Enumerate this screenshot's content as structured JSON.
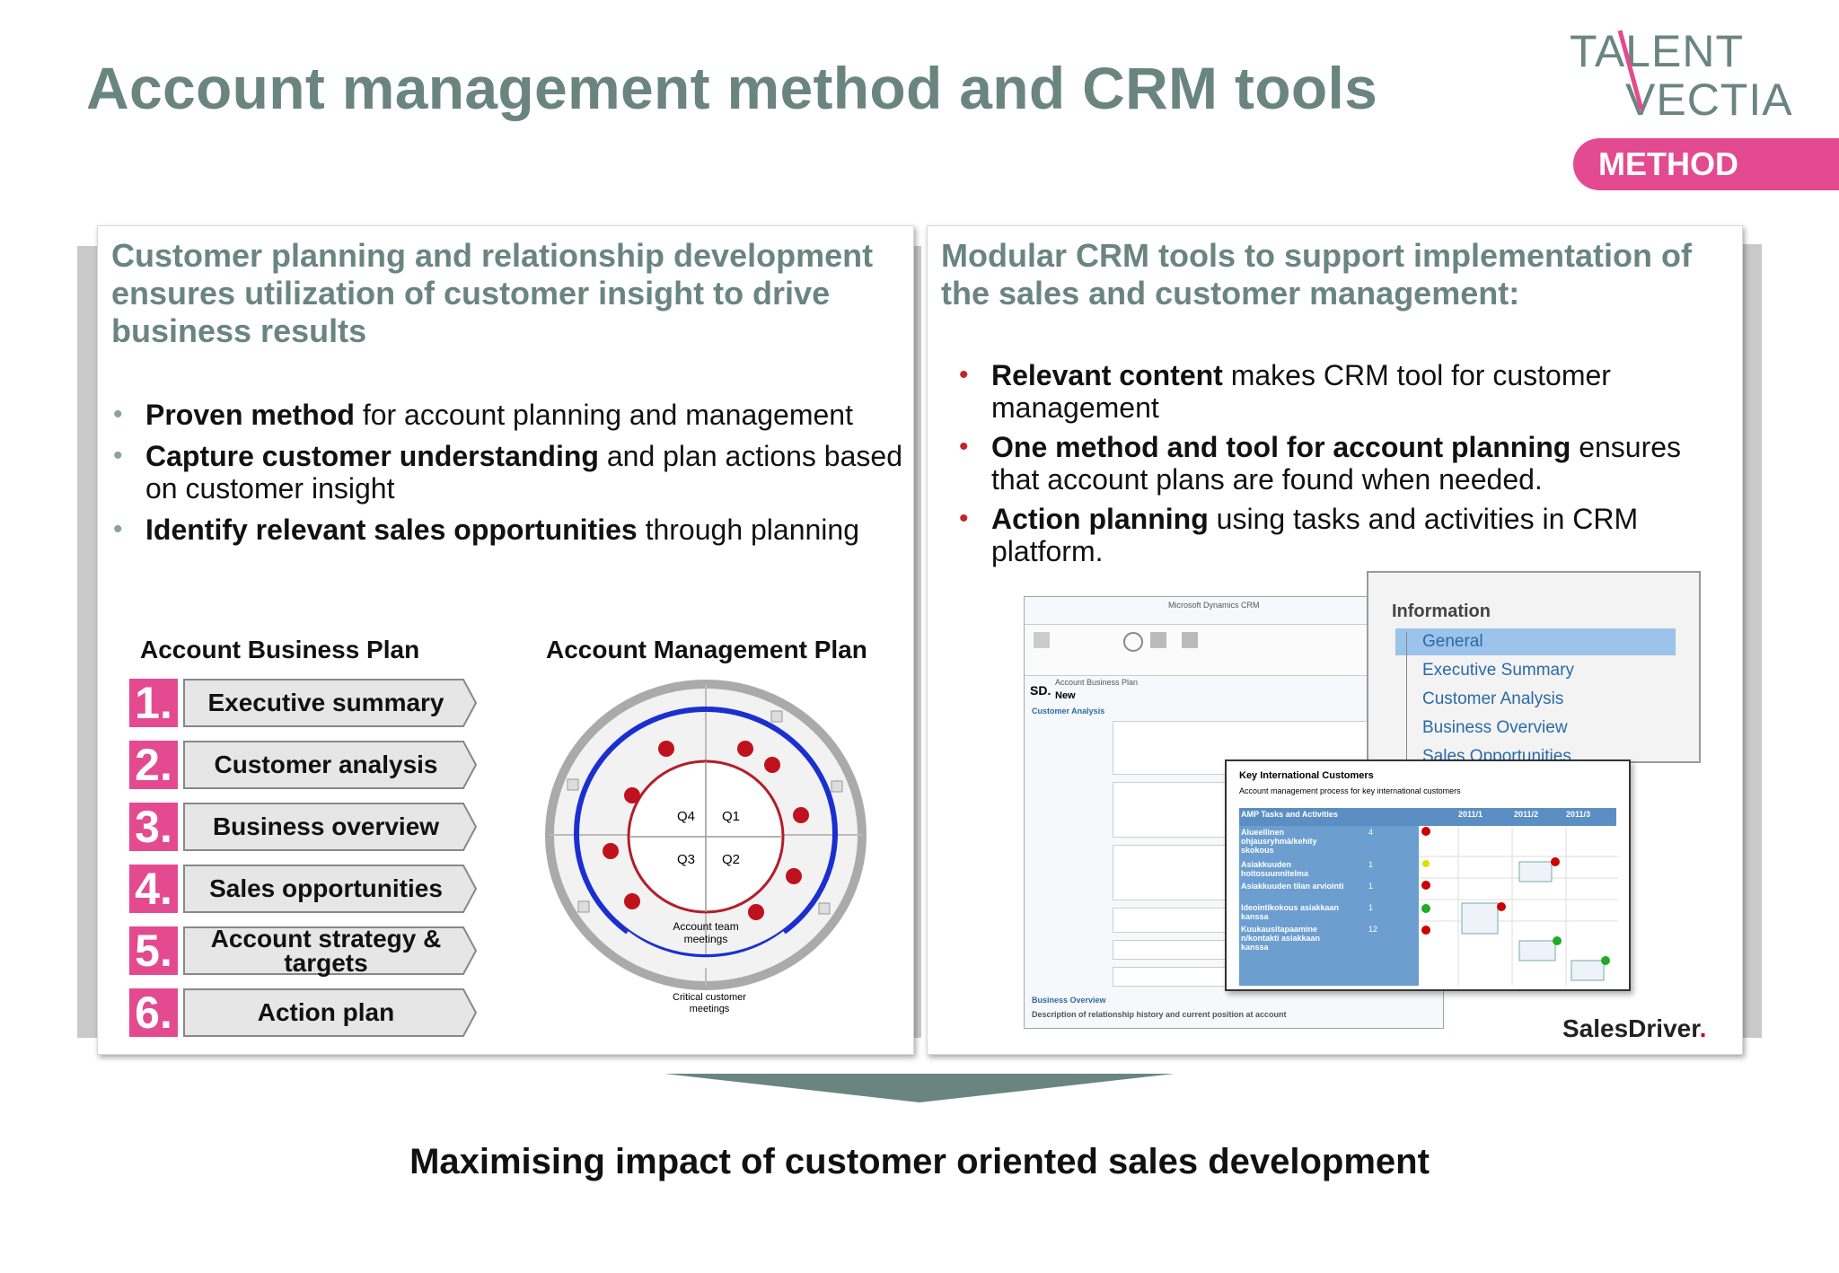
{
  "title": "Account management method and CRM tools",
  "logo": {
    "line1": "TALENT",
    "line2": "VECTIA"
  },
  "badge": "METHOD",
  "left_panel": {
    "heading": "Customer planning and relationship development ensures utilization of customer insight to drive business results",
    "bullets": [
      {
        "bold": "Proven method",
        "rest": " for account planning and management"
      },
      {
        "bold": "Capture customer understanding",
        "rest": " and plan actions based on customer insight"
      },
      {
        "bold": "Identify relevant sales opportunities",
        "rest": " through planning"
      }
    ],
    "account_business_plan": {
      "title": "Account Business Plan",
      "steps": [
        {
          "num": "1.",
          "label": "Executive summary"
        },
        {
          "num": "2.",
          "label": "Customer analysis"
        },
        {
          "num": "3.",
          "label": "Business overview"
        },
        {
          "num": "4.",
          "label": "Sales opportunities"
        },
        {
          "num": "5.",
          "label": "Account strategy & targets"
        },
        {
          "num": "6.",
          "label": "Action plan"
        }
      ]
    },
    "account_management_plan": {
      "title": "Account Management Plan",
      "quadrants": [
        "Q4",
        "Q1",
        "Q3",
        "Q2"
      ],
      "inner_label": "Account team meetings",
      "outer_label": "Critical customer meetings"
    }
  },
  "right_panel": {
    "heading": "Modular CRM tools to support implementation of the sales and customer management:",
    "bullets": [
      {
        "bold": "Relevant content",
        "rest": " makes CRM tool for customer management"
      },
      {
        "bold": "One method and tool for account planning",
        "rest": "  ensures that account plans are found when needed."
      },
      {
        "bold": "Action planning",
        "rest": " using tasks and activities in CRM platform."
      }
    ],
    "crm_form": {
      "app_title": "Microsoft Dynamics CRM",
      "record_type": "Account Business Plan",
      "record_name": "New",
      "section1": "Customer Analysis",
      "section2": "Business Overview",
      "footer_text": "Description of relationship history and current position at account"
    },
    "info_panel": {
      "title": "Information",
      "items": [
        "General",
        "Executive Summary",
        "Customer Analysis",
        "Business Overview",
        "Sales Opportunities"
      ]
    },
    "key_customers": {
      "title": "Key International Customers",
      "subtitle": "Account management process for key international customers",
      "header": [
        "AMP Tasks and Activities",
        "2011/1",
        "2011/2",
        "2011/3"
      ],
      "rows": [
        {
          "name": "Alueellinen ohjausryhmä/kehity skokous",
          "n": "4"
        },
        {
          "name": "Asiakkuuden hoitosuunnitelma",
          "n": "1"
        },
        {
          "name": "Asiakkuuden tilan arviointi",
          "n": "1"
        },
        {
          "name": "Ideointikokous asiakkaan kanssa",
          "n": "1"
        },
        {
          "name": "Kuukausitapaamine n/kontakti asiakkaan kanssa",
          "n": "12"
        }
      ]
    },
    "brand": "SalesDriver"
  },
  "footer": "Maximising impact of customer oriented sales development",
  "colors": {
    "heading": "#6a8580",
    "accent_pink": "#e44a8f",
    "bullet_red": "#c0272d"
  }
}
